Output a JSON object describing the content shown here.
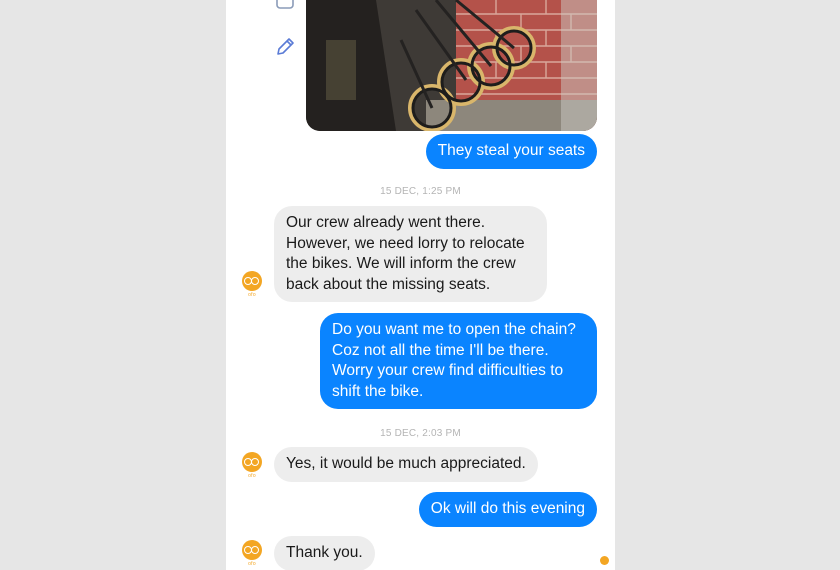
{
  "chat": {
    "messages": [
      {
        "type": "outgoing",
        "text": "They steal your seats"
      },
      {
        "type": "timestamp",
        "text": "15 DEC, 1:25 PM"
      },
      {
        "type": "incoming",
        "text": "Our crew already went there.\nHowever, we need lorry to relocate\nthe bikes. We will inform the crew\nback about the missing seats."
      },
      {
        "type": "outgoing",
        "text": "Do you want me to open the chain?\nCoz not all the time I'll be there.\nWorry your crew find difficulties to\nshift the bike."
      },
      {
        "type": "timestamp",
        "text": "15 DEC, 2:03 PM"
      },
      {
        "type": "incoming",
        "text": "Yes, it would be much appreciated."
      },
      {
        "type": "outgoing",
        "text": "Ok will do this evening"
      },
      {
        "type": "incoming",
        "text": "Thank you."
      }
    ]
  },
  "avatar": {
    "brand": "ofo",
    "color": "#f3a623"
  },
  "colors": {
    "outgoing": "#0a84ff",
    "incoming": "#ededed",
    "background": "#e6e6e6"
  },
  "icons": [
    "square-icon",
    "pencil-icon"
  ]
}
